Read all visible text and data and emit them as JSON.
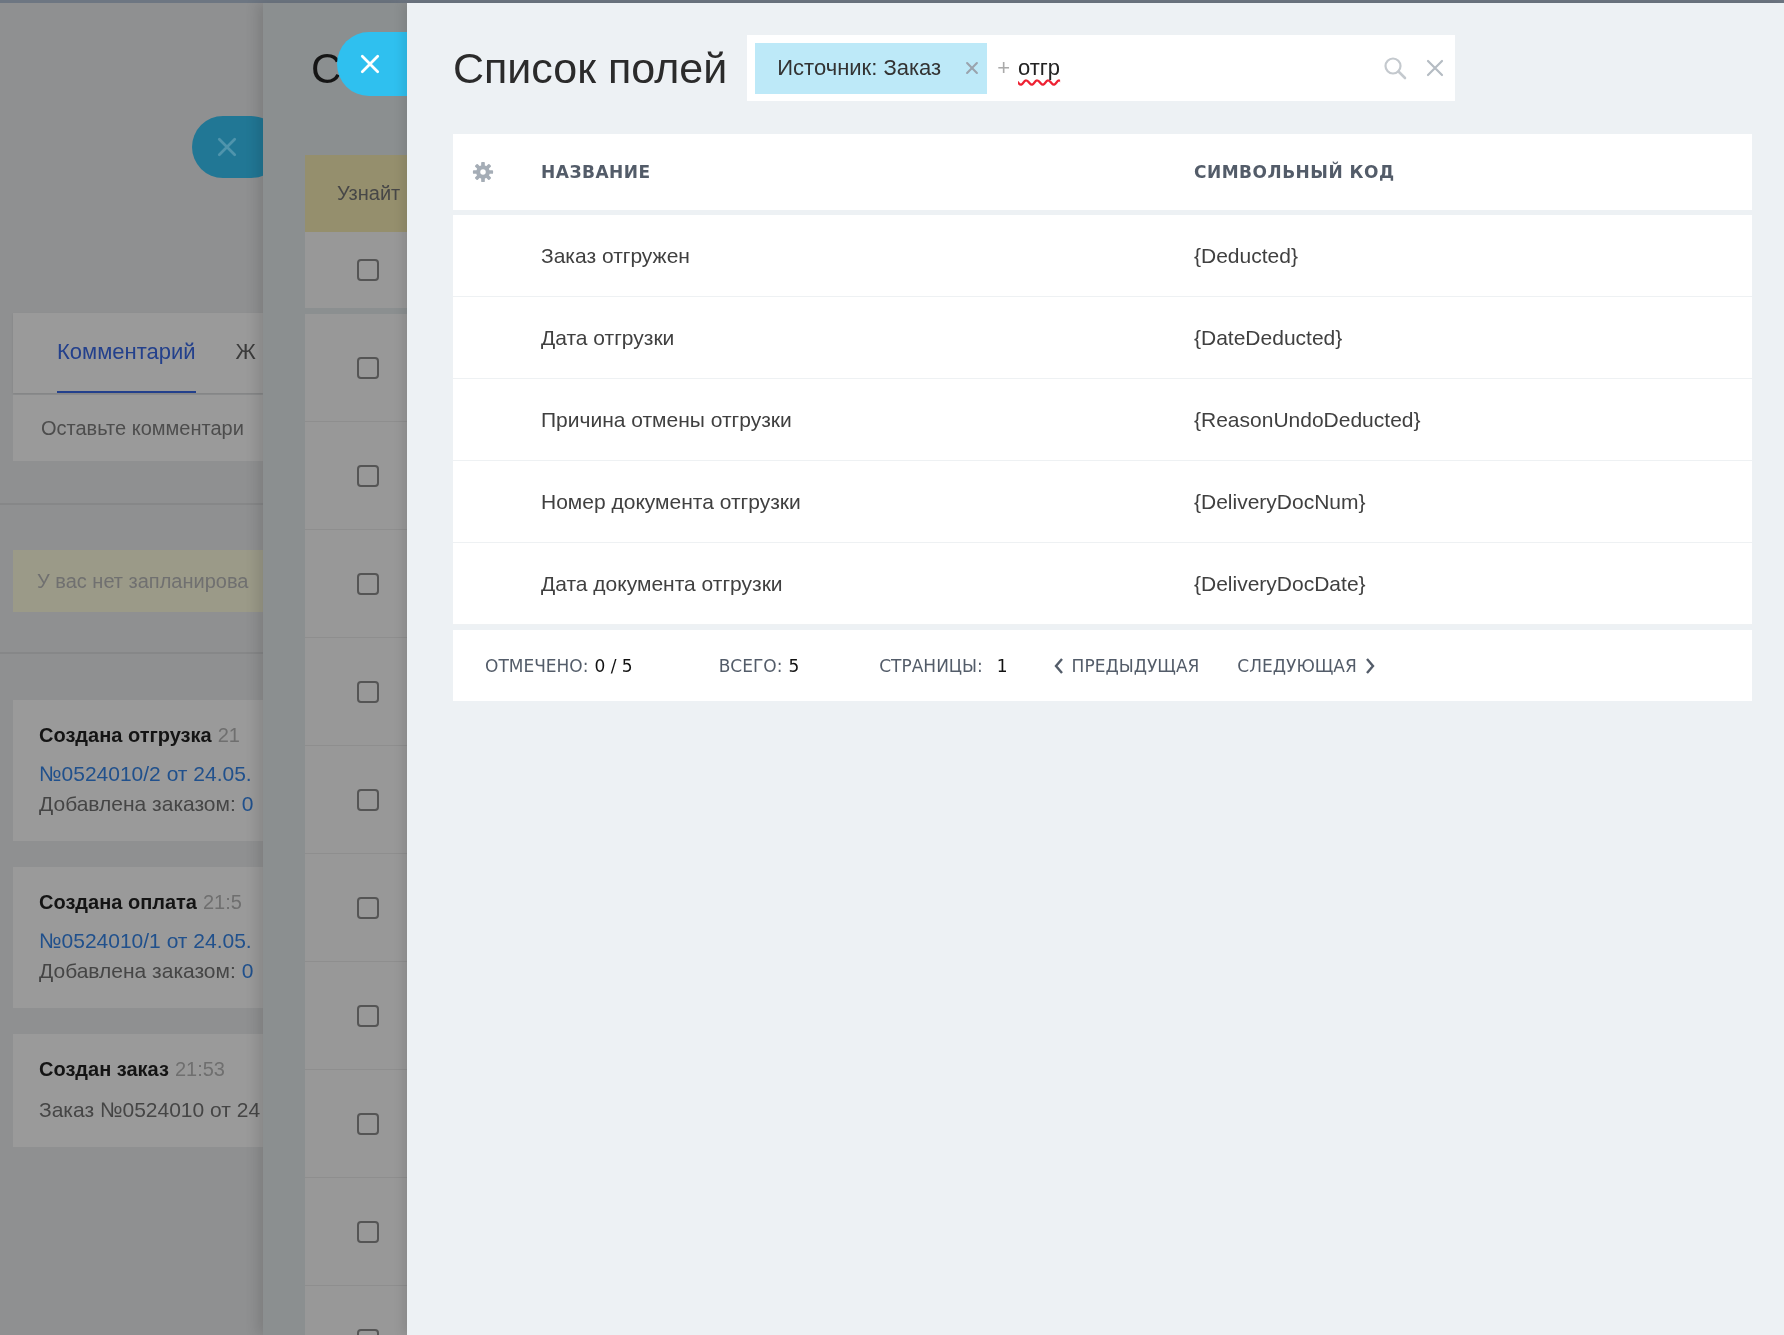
{
  "background_page": {
    "tabs": [
      {
        "label": "Комментарий",
        "selected": true
      },
      {
        "label": "Ж",
        "selected": false
      }
    ],
    "comment_placeholder": "Оставьте комментари",
    "notice": "У вас нет запланирова",
    "timeline": [
      {
        "kind": "document",
        "title": "Создана отгрузка",
        "time": "21",
        "link": "№0524010/2 от 24.05.",
        "added_label": "Добавлена заказом:",
        "added_link": "0"
      },
      {
        "kind": "document",
        "title": "Создана оплата",
        "time": "21:5",
        "link": "№0524010/1 от 24.05.",
        "added_label": "Добавлена заказом:",
        "added_link": "0"
      },
      {
        "kind": "order",
        "title": "Создан заказ",
        "time": "21:53",
        "text": "Заказ №0524010 от 24"
      }
    ]
  },
  "middle_panel": {
    "title": "С",
    "notice": "Узнайт",
    "rows": [
      {
        "checked": false
      },
      {
        "checked": false
      },
      {
        "checked": false
      },
      {
        "checked": false
      },
      {
        "checked": false
      },
      {
        "checked": false
      },
      {
        "checked": false
      },
      {
        "checked": false
      },
      {
        "checked": false
      },
      {
        "checked": false
      },
      {
        "checked": false
      }
    ]
  },
  "field_list": {
    "title": "Список полей",
    "search": {
      "filter_tag": "Источник: Заказ",
      "add_symbol": "+",
      "value": "отгр"
    },
    "table": {
      "columns": [
        "НАЗВАНИЕ",
        "СИМВОЛЬНЫЙ КОД"
      ],
      "rows": [
        {
          "name": "Заказ отгружен",
          "code": "{Deducted}"
        },
        {
          "name": "Дата отгрузки",
          "code": "{DateDeducted}"
        },
        {
          "name": "Причина отмены отгрузки",
          "code": "{ReasonUndoDeducted}"
        },
        {
          "name": "Номер документа отгрузки",
          "code": "{DeliveryDocNum}"
        },
        {
          "name": "Дата документа отгрузки",
          "code": "{DeliveryDocDate}"
        }
      ]
    },
    "footer": {
      "checked_label": "ОТМЕЧЕНО:",
      "checked_value": "0 / 5",
      "total_label": "ВСЕГО:",
      "total_value": "5",
      "pages_label": "СТРАНИЦЫ:",
      "pages_value": "1",
      "prev": "ПРЕДЫДУЩАЯ",
      "next": "СЛЕДУЮЩАЯ"
    }
  }
}
